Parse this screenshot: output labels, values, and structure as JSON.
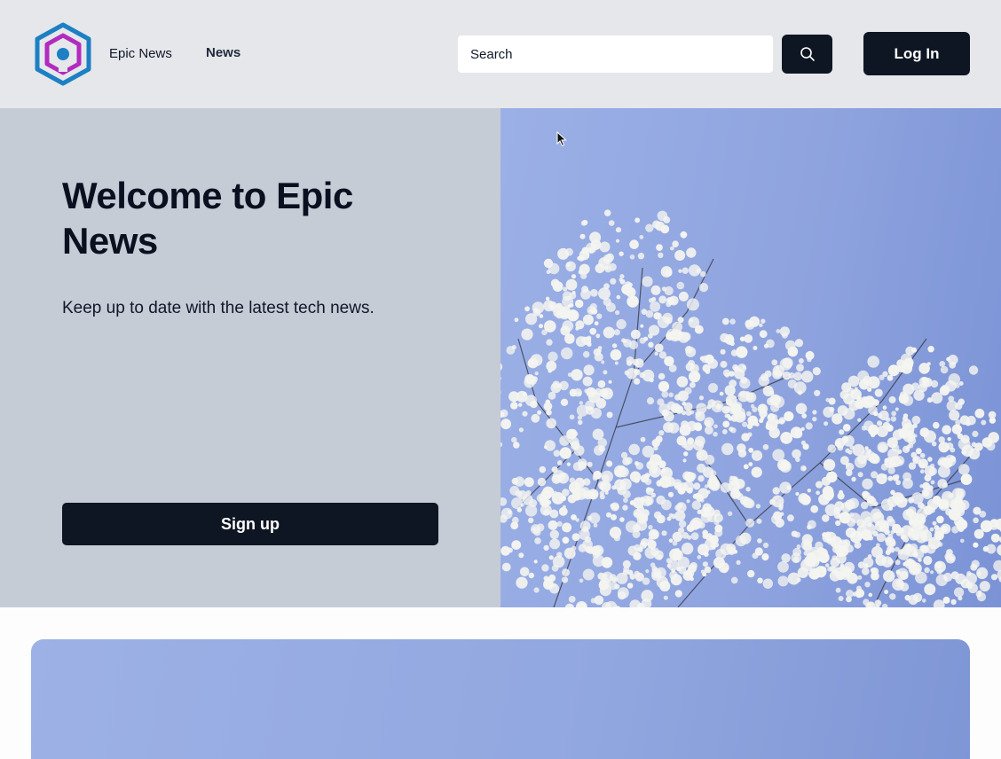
{
  "header": {
    "brand": "Epic News",
    "nav_news": "News",
    "search_placeholder": "Search",
    "login_label": "Log In"
  },
  "hero": {
    "title": "Welcome to Epic News",
    "subtitle": "Keep up to date with the latest tech news.",
    "signup_label": "Sign up"
  },
  "icons": {
    "logo": "hexagon-logo-icon",
    "search": "search-icon",
    "cursor": "mouse-pointer-icon"
  },
  "colors": {
    "header_bg": "#e6e7ea",
    "hero_left_bg": "#c6ccd6",
    "button_dark": "#0f1623",
    "sky_blue": "#8fa4df",
    "logo_blue": "#1d7fc4",
    "logo_purple": "#b12bbf"
  }
}
